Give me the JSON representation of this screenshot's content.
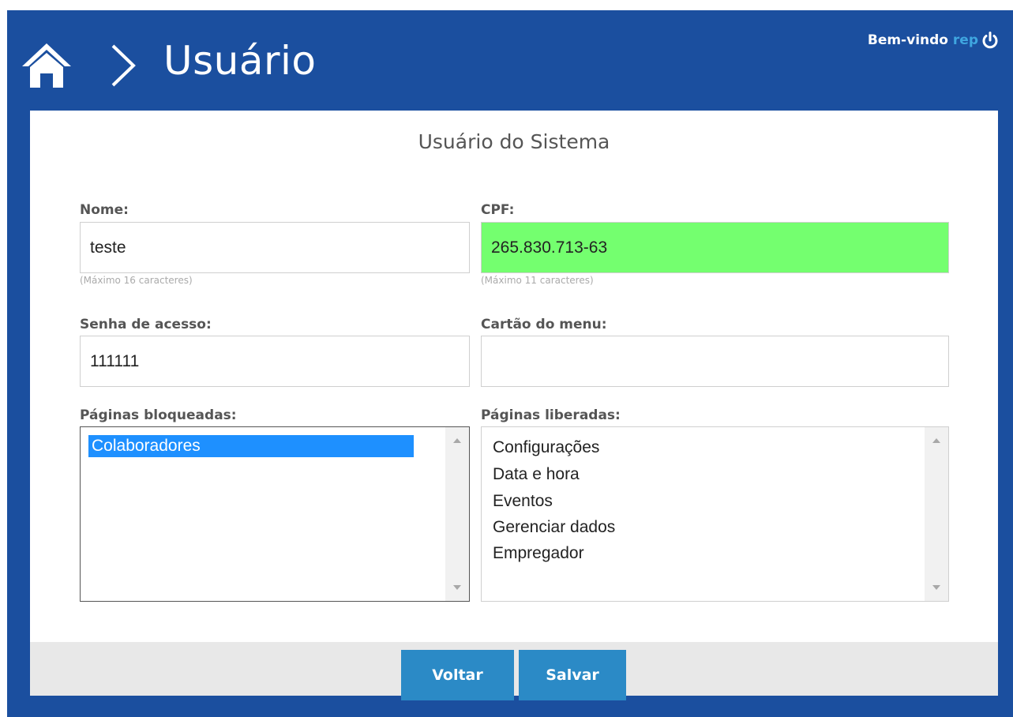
{
  "header": {
    "title": "Usuário",
    "welcome_text": "Bem-vindo",
    "username": "rep",
    "icons": {
      "home": "home-icon",
      "separator": "chevron-right-icon",
      "logout": "power-icon"
    },
    "colors": {
      "background": "#1b4f9f",
      "username": "#3fa6e0"
    }
  },
  "form": {
    "title": "Usuário do Sistema",
    "nome": {
      "label": "Nome:",
      "value": "teste",
      "hint": "(Máximo 16 caracteres)"
    },
    "cpf": {
      "label": "CPF:",
      "value": "265.830.713-63",
      "hint": "(Máximo 11 caracteres)",
      "valid_color": "#74ff6f"
    },
    "senha": {
      "label": "Senha de acesso:",
      "value": "111111"
    },
    "cartao": {
      "label": "Cartão do menu:",
      "value": ""
    },
    "blocked": {
      "label": "Páginas bloqueadas:",
      "items": [
        "Colaboradores"
      ],
      "selected": "Colaboradores"
    },
    "allowed": {
      "label": "Páginas liberadas:",
      "items": [
        "Configurações",
        "Data e hora",
        "Eventos",
        "Gerenciar dados",
        "Empregador"
      ]
    }
  },
  "footer": {
    "back_label": "Voltar",
    "save_label": "Salvar",
    "button_color": "#2b8ac6"
  }
}
